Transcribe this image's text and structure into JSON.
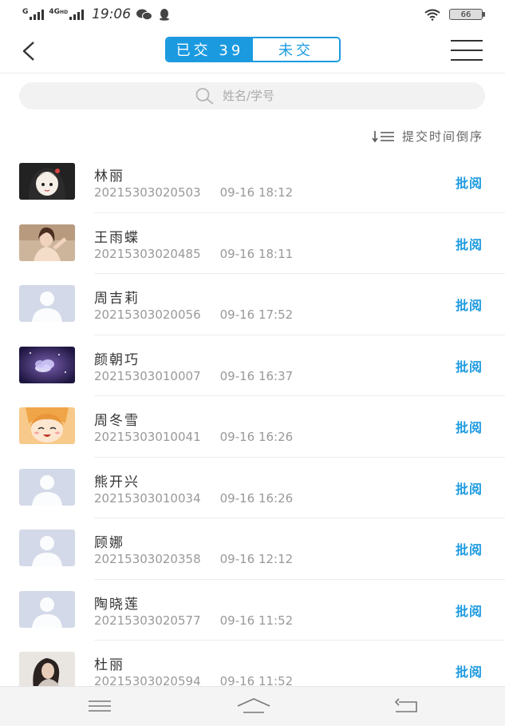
{
  "status_bar": {
    "network_top": "G",
    "network_second": "4G",
    "network_hd": "HD",
    "time": "19:06",
    "battery": "66"
  },
  "nav": {
    "tab_submitted": "已交 39",
    "tab_unsubmitted": "未交"
  },
  "search": {
    "placeholder": "姓名/学号"
  },
  "sort": {
    "label": "提交时间倒序"
  },
  "students": [
    {
      "name": "林丽",
      "id": "20215303020503",
      "time": "09-16 18:12",
      "action": "批阅",
      "avatar": "cartoon-girl-avatar"
    },
    {
      "name": "王雨蝶",
      "id": "20215303020485",
      "time": "09-16 18:11",
      "action": "批阅",
      "avatar": "photo-avatar"
    },
    {
      "name": "周吉莉",
      "id": "20215303020056",
      "time": "09-16 17:52",
      "action": "批阅",
      "avatar": "default-avatar"
    },
    {
      "name": "颜朝巧",
      "id": "20215303010007",
      "time": "09-16 16:37",
      "action": "批阅",
      "avatar": "flower-avatar"
    },
    {
      "name": "周冬雪",
      "id": "20215303010041",
      "time": "09-16 16:26",
      "action": "批阅",
      "avatar": "anime-avatar"
    },
    {
      "name": "熊开兴",
      "id": "20215303010034",
      "time": "09-16 16:26",
      "action": "批阅",
      "avatar": "default-avatar"
    },
    {
      "name": "顾娜",
      "id": "20215303020358",
      "time": "09-16 12:12",
      "action": "批阅",
      "avatar": "default-avatar"
    },
    {
      "name": "陶晓莲",
      "id": "20215303020577",
      "time": "09-16 11:52",
      "action": "批阅",
      "avatar": "default-avatar"
    },
    {
      "name": "杜丽",
      "id": "20215303020594",
      "time": "09-16 11:52",
      "action": "批阅",
      "avatar": "photo-avatar"
    }
  ],
  "colors": {
    "accent": "#1b9ae0",
    "muted_text": "#999999",
    "default_avatar": "#d3d9e8"
  }
}
